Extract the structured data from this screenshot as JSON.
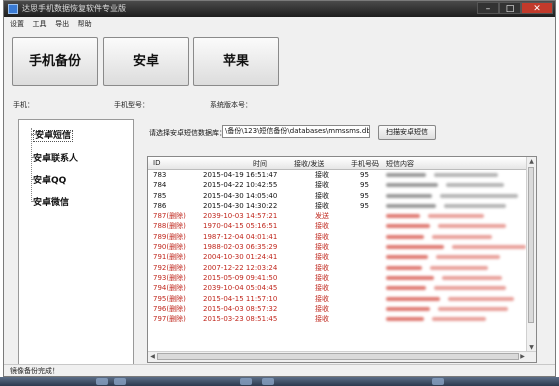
{
  "window": {
    "title": "达思手机数据恢复软件专业版",
    "min_glyph": "–",
    "max_glyph": "□",
    "close_glyph": "✕"
  },
  "menu": [
    "设置",
    "工具",
    "导出",
    "帮助"
  ],
  "buttons": {
    "phone_backup": "手机备份",
    "android": "安卓",
    "apple": "苹果"
  },
  "info": {
    "phone_label": "手机：",
    "model_label": "手机型号：",
    "version_label": "系统版本号："
  },
  "tree": [
    {
      "label": "安卓短信",
      "selected": true
    },
    {
      "label": "安卓联系人",
      "selected": false
    },
    {
      "label": "安卓QQ",
      "selected": false
    },
    {
      "label": "安卓微信",
      "selected": false
    }
  ],
  "db_path": {
    "label": "请选择安卓短信数据库：",
    "value": "\\备份\\123\\短信备份\\databases\\mmssms.db",
    "scan_button": "扫描安卓短信"
  },
  "table": {
    "headers": {
      "id": "ID",
      "time": "时间",
      "type": "接收/发送",
      "phone": "手机号码",
      "content": "短信内容"
    },
    "rows": [
      {
        "id": "783",
        "time": "2015-04-19 16:51:47",
        "type": "接收",
        "phone": "95",
        "deleted": false
      },
      {
        "id": "784",
        "time": "2015-04-22 10:42:55",
        "type": "接收",
        "phone": "95",
        "deleted": false
      },
      {
        "id": "785",
        "time": "2015-04-30 14:05:40",
        "type": "接收",
        "phone": "95",
        "deleted": false
      },
      {
        "id": "786",
        "time": "2015-04-30 14:30:22",
        "type": "接收",
        "phone": "95",
        "deleted": false
      },
      {
        "id": "787(删除)",
        "time": "2039-10-03 14:57:21",
        "type": "发送",
        "phone": "",
        "deleted": true
      },
      {
        "id": "788(删除)",
        "time": "1970-04-15 05:16:51",
        "type": "接收",
        "phone": "",
        "deleted": true
      },
      {
        "id": "789(删除)",
        "time": "1987-12-04 04:01:41",
        "type": "接收",
        "phone": "",
        "deleted": true
      },
      {
        "id": "790(删除)",
        "time": "1988-02-03 06:35:29",
        "type": "接收",
        "phone": "",
        "deleted": true
      },
      {
        "id": "791(删除)",
        "time": "2004-10-30 01:24:41",
        "type": "接收",
        "phone": "",
        "deleted": true
      },
      {
        "id": "792(删除)",
        "time": "2007-12-22 12:03:24",
        "type": "接收",
        "phone": "",
        "deleted": true
      },
      {
        "id": "793(删除)",
        "time": "2015-05-09 09:41:50",
        "type": "接收",
        "phone": "",
        "deleted": true
      },
      {
        "id": "794(删除)",
        "time": "2039-10-04 05:04:45",
        "type": "接收",
        "phone": "",
        "deleted": true
      },
      {
        "id": "795(删除)",
        "time": "2015-04-15 11:57:10",
        "type": "接收",
        "phone": "",
        "deleted": true
      },
      {
        "id": "796(删除)",
        "time": "2015-04-03 08:57:32",
        "type": "接收",
        "phone": "",
        "deleted": true
      },
      {
        "id": "797(删除)",
        "time": "2015-03-23 08:51:45",
        "type": "接收",
        "phone": "",
        "deleted": true
      }
    ]
  },
  "status": "镜像备份完成！",
  "colors": {
    "deleted_row": "#c0281e",
    "close_button": "#c23a2b"
  }
}
